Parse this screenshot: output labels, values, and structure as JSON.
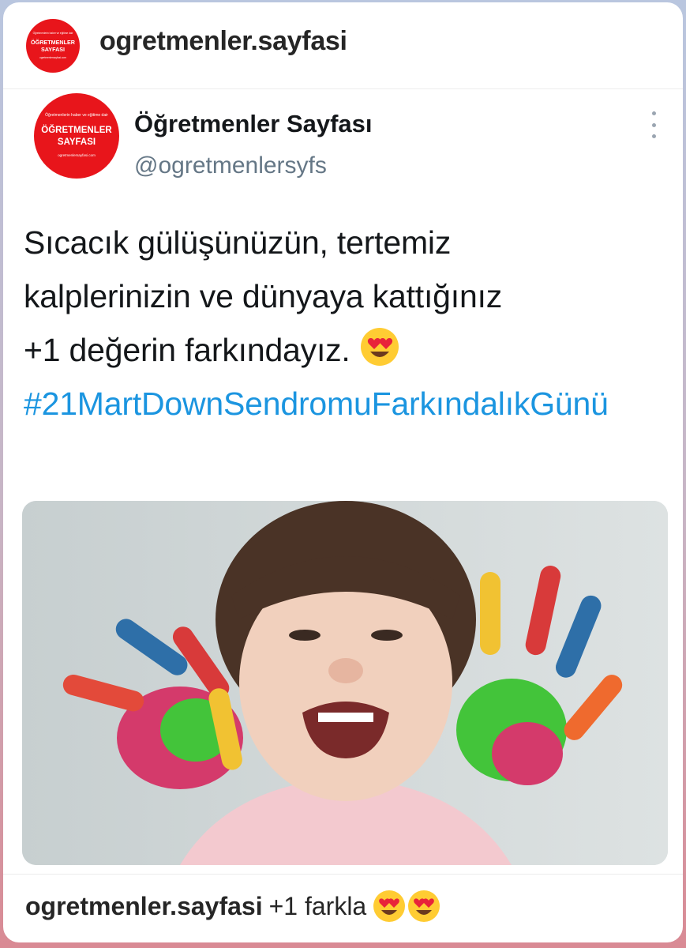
{
  "instagram": {
    "username": "ogretmenler.sayfasi",
    "caption_user": "ogretmenler.sayfasi",
    "caption_text": "+1 farkla",
    "caption_emojis": [
      "heart-eyes-emoji",
      "heart-eyes-emoji"
    ]
  },
  "logo": {
    "top_text": "Öğretmenlerin haber ve eğitime dair",
    "line1": "ÖĞRETMENLER",
    "line2": "SAYFASI",
    "bottom_text": "ogretmenlersayfasi.com"
  },
  "tweet": {
    "name": "Öğretmenler Sayfası",
    "handle": "@ogretmenlersyfs",
    "line1": "Sıcacık gülüşünüzün, tertemiz",
    "line2": "kalplerinizin ve dünyaya kattığınız",
    "line3": "+1 değerin farkındayız.",
    "hashtag": "#21MartDownSendromuFarkındalıkGünü",
    "emoji": "heart-eyes-emoji"
  },
  "image": {
    "description_icon": "child-with-painted-hands-photo"
  },
  "colors": {
    "logo_red": "#e8151b",
    "hashtag_blue": "#1b95e0",
    "text_dark": "#14171a",
    "handle_gray": "#657786"
  }
}
